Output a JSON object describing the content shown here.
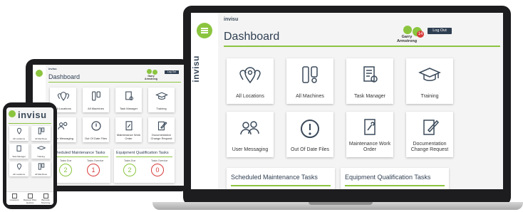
{
  "brand": {
    "logo_text": "invisu",
    "vertical_logo": "invisu",
    "accent": "#8bc53f",
    "dark": "#2f3f52",
    "alert": "#d83a3a"
  },
  "laptop": {
    "title": "Dashboard",
    "user": "Garry Armstrong",
    "notification_count": "14",
    "logout_label": "Log Out",
    "tiles": [
      {
        "label": "All Locations",
        "icon": "location-pins-icon"
      },
      {
        "label": "All Machines",
        "icon": "machines-icon"
      },
      {
        "label": "Task Manager",
        "icon": "task-manager-icon"
      },
      {
        "label": "Training",
        "icon": "graduation-cap-icon"
      },
      {
        "label": "User Messaging",
        "icon": "users-icon"
      },
      {
        "label": "Out Of Date Files",
        "icon": "alert-circle-icon"
      },
      {
        "label": "Maintenance Work Order",
        "icon": "wrench-document-icon"
      },
      {
        "label": "Documentation Change Request",
        "icon": "document-edit-icon"
      }
    ],
    "panels": [
      "Scheduled Maintenance Tasks",
      "Equipment Qualification Tasks"
    ]
  },
  "tablet": {
    "title": "Dashboard",
    "user": "Garry Armstrong",
    "logout_label": "Log Out",
    "tiles": [
      {
        "label": "All Locations"
      },
      {
        "label": "All Machines"
      },
      {
        "label": "Task Manager"
      },
      {
        "label": "Training"
      },
      {
        "label": "User Messaging"
      },
      {
        "label": "Out Of Date Files"
      },
      {
        "label": "Maintenance Work Order"
      },
      {
        "label": "Documentation Change Request"
      }
    ],
    "panels": [
      {
        "title": "Scheduled Maintenance Tasks",
        "due_label": "Tasks Due",
        "overdue_label": "Tasks Overdue",
        "due": "2",
        "overdue": "1"
      },
      {
        "title": "Equipment Qualification Tasks",
        "due_label": "Tasks Due",
        "overdue_label": "Tasks Overdue",
        "due": "2",
        "overdue": "0"
      }
    ]
  },
  "phone": {
    "tiles": [
      {
        "label": "All Locations"
      },
      {
        "label": "All Machines"
      },
      {
        "label": "Task Manager"
      },
      {
        "label": "Training"
      },
      {
        "label": "All Locations"
      },
      {
        "label": "All Machines"
      }
    ],
    "bottom": [
      {
        "label": "Locations"
      },
      {
        "label": "Request Files Queries"
      },
      {
        "label": "Barcode Scanning"
      }
    ]
  }
}
